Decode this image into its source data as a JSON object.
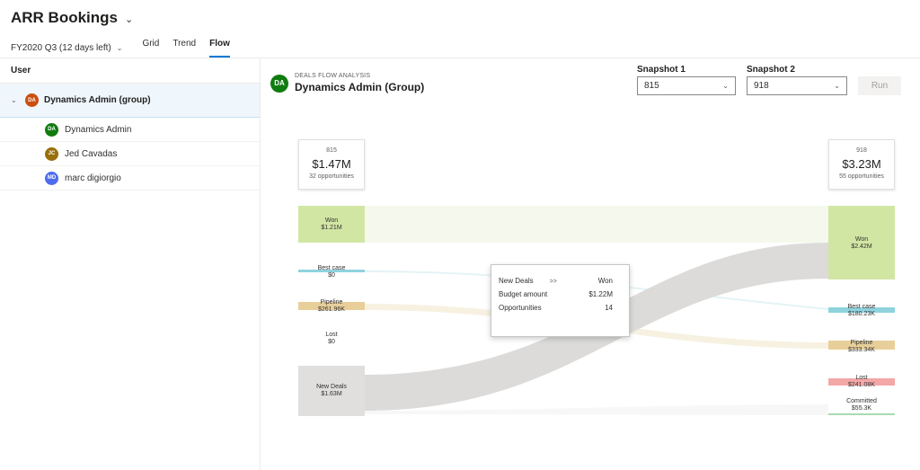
{
  "header": {
    "title": "ARR Bookings",
    "period": "FY2020 Q3 (12 days left)",
    "tabs": [
      "Grid",
      "Trend",
      "Flow"
    ]
  },
  "sidebar": {
    "column_header": "User",
    "group": {
      "initials": "DA",
      "name": "Dynamics Admin (group)",
      "color": "#ca5010"
    },
    "users": [
      {
        "initials": "DA",
        "name": "Dynamics Admin",
        "color": "#107c10"
      },
      {
        "initials": "JC",
        "name": "Jed Cavadas",
        "color": "#986f0b"
      },
      {
        "initials": "MD",
        "name": "marc digiorgio",
        "color": "#4f6bed"
      }
    ]
  },
  "analysis": {
    "initials": "DA",
    "subtitle": "DEALS FLOW ANALYSIS",
    "title": "Dynamics Admin (Group)",
    "avatar_color": "#107c10"
  },
  "snapshots": {
    "label1": "Snapshot 1",
    "value1": "815",
    "label2": "Snapshot 2",
    "value2": "918",
    "run_label": "Run"
  },
  "summary": {
    "left": {
      "snapshot": "815",
      "amount": "$1.47M",
      "count": "32 opportunities"
    },
    "right": {
      "snapshot": "918",
      "amount": "$3.23M",
      "count": "55 opportunities"
    }
  },
  "left_nodes": [
    {
      "name": "Won",
      "value": "$1.21M",
      "color": "#d2e6a4"
    },
    {
      "name": "Best case",
      "value": "$0",
      "color": "#8fd3de"
    },
    {
      "name": "Pipeline",
      "value": "$261.96K",
      "color": "#e8cf9a"
    },
    {
      "name": "Lost",
      "value": "$0",
      "color": "#ffffff"
    },
    {
      "name": "New Deals",
      "value": "$1.63M",
      "color": "#e1dfdd"
    }
  ],
  "right_nodes": [
    {
      "name": "Won",
      "value": "$2.42M",
      "color": "#d2e6a4"
    },
    {
      "name": "Best case",
      "value": "$180.23K",
      "color": "#8fd3de"
    },
    {
      "name": "Pipeline",
      "value": "$333.34K",
      "color": "#e8cf9a"
    },
    {
      "name": "Lost",
      "value": "$241.08K",
      "color": "#f4a7a7"
    },
    {
      "name": "Committed",
      "value": "$55.3K",
      "color": "#a8dbb0"
    }
  ],
  "tooltip": {
    "from": "New Deals",
    "arrow": ">>",
    "to": "Won",
    "rows": [
      {
        "label": "Budget amount",
        "value": "$1.22M"
      },
      {
        "label": "Opportunities",
        "value": "14"
      }
    ]
  }
}
